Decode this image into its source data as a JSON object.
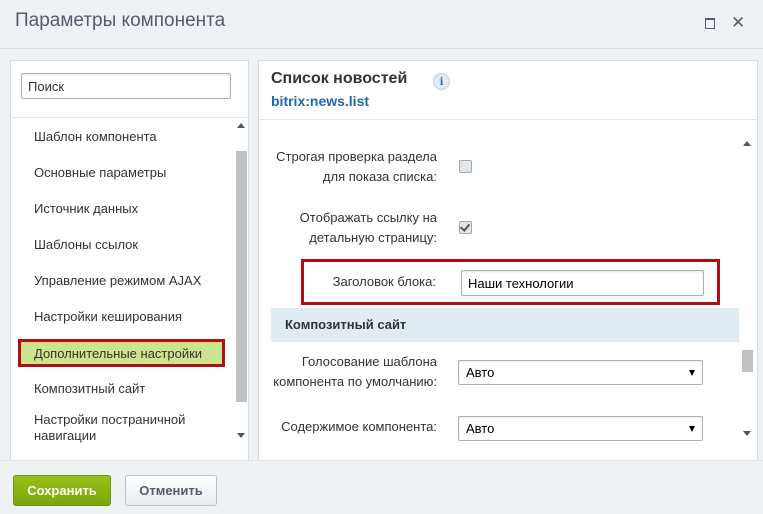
{
  "window": {
    "title": "Параметры компонента"
  },
  "sidebar": {
    "search_placeholder": "Поиск",
    "items": [
      {
        "label": "Шаблон компонента"
      },
      {
        "label": "Основные параметры"
      },
      {
        "label": "Источник данных"
      },
      {
        "label": "Шаблоны ссылок"
      },
      {
        "label": "Управление режимом AJAX"
      },
      {
        "label": "Настройки кеширования"
      },
      {
        "label": "Дополнительные настройки",
        "active": true
      },
      {
        "label": "Композитный сайт"
      },
      {
        "label": "Настройки постраничной навигации"
      }
    ]
  },
  "component": {
    "title": "Список новостей",
    "code": "bitrix:news.list",
    "info_icon": "info-icon"
  },
  "properties": {
    "strict_check": {
      "label": "Строгая проверка раздела для показа списка:",
      "checked": false
    },
    "show_detail_link": {
      "label": "Отображать ссылку на детальную страницу:",
      "checked": true
    },
    "block_title": {
      "label": "Заголовок блока:",
      "value": "Наши технологии"
    },
    "composite_section": "Композитный сайт",
    "template_voting": {
      "label": "Голосование шаблона компонента по умолчанию:",
      "value": "Авто"
    },
    "component_content": {
      "label": "Содержимое компонента:",
      "value": "Авто"
    }
  },
  "footer": {
    "save_label": "Сохранить",
    "cancel_label": "Отменить"
  },
  "colors": {
    "accent_green": "#7ba50c",
    "highlight_red": "#b00d14",
    "link_blue": "#2067b0"
  }
}
